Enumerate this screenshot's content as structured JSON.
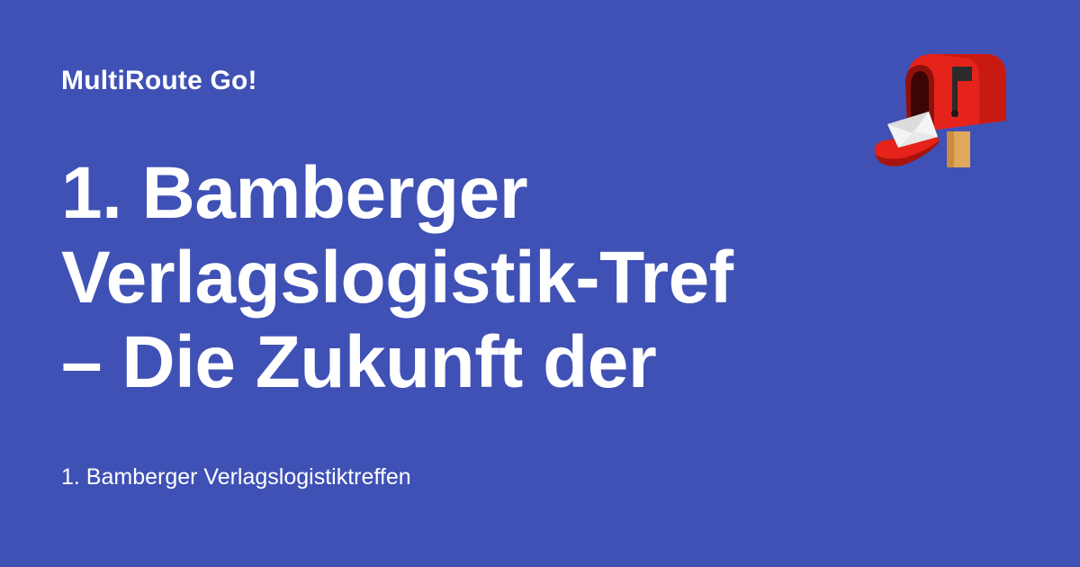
{
  "site": {
    "name": "MultiRoute Go!"
  },
  "headline": {
    "lines": [
      "1. Bamberger",
      "Verlagslogistik-Tref",
      "– Die Zukunft der"
    ]
  },
  "description": "1. Bamberger Verlagslogistiktreffen",
  "colors": {
    "background": "#3f51b5",
    "text": "#ffffff",
    "mailbox_red": "#e5231b",
    "post_wood": "#e0a85a"
  },
  "icons": {
    "logo": "mailbox-icon"
  }
}
